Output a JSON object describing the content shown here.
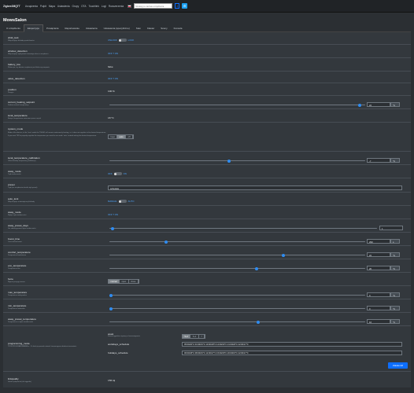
{
  "topbar": {
    "brand": "Zigbee2MQTT",
    "nav": [
      "Urządzenia",
      "Pulpit",
      "Mapa",
      "Ustawienia",
      "Grupy",
      "OTA",
      "Touchlink",
      "Logi",
      "Rozszerzenia"
    ],
    "search_placeholder": "Szukaj po nazwie urządzenia",
    "lock_icon": "lock-icon",
    "settings_icon": "gear-icon"
  },
  "page_title": "MowsSalon",
  "tabs": [
    {
      "label": "O urządzeniu",
      "active": false
    },
    {
      "label": "Ekspozycje",
      "active": true
    },
    {
      "label": "Powiązania",
      "active": false
    },
    {
      "label": "Raportowanie",
      "active": false
    },
    {
      "label": "Ustawienia",
      "active": false
    },
    {
      "label": "Ustawienia (specyficzne)",
      "active": false
    },
    {
      "label": "Stan",
      "active": false
    },
    {
      "label": "Klaster",
      "active": false
    },
    {
      "label": "Sceny",
      "active": false
    },
    {
      "label": "Konsola",
      "active": false
    }
  ],
  "rows": {
    "child_lock": {
      "name": "child_lock",
      "desc": "Włącz/wyłącz blokadę przed dziećmi",
      "left": "UNLOCK",
      "right": "LOCK"
    },
    "window_detection": {
      "name": "window_detection",
      "desc": "Włącz/wyłącz wykrywanie otwartego okna w urządzeniu",
      "value": "OFF ? ON"
    },
    "battery_low": {
      "name": "battery_low",
      "desc": "Wskazuje, czy bateria urządzenia jest bliska wyczerpania",
      "value": "false"
    },
    "valve_detection": {
      "name": "valve_detection",
      "value": "OFF ? ON"
    },
    "position": {
      "name": "position",
      "desc": "Pozycja",
      "value": "100 %"
    },
    "current_heating_setpoint": {
      "name": "current_heating_setpoint",
      "desc": "Zadana wartość temperatury",
      "value": "22",
      "unit": "°C"
    },
    "local_temperature": {
      "name": "local_temperature",
      "desc": "Bieżąca temperatura zmierzona przez czujnik",
      "value": "18 °C"
    },
    "system_mode": {
      "name": "system_mode",
      "desc": "Mode of this device, in the `heat` mode the TS0601 will remain continuously heating, i.e. it does not regulate to the desired temperature. If you want TRV to properly regulate the temperature you need to use mode `auto` instead setting the desired temperature.",
      "options": [
        "heat",
        "auto",
        "off"
      ],
      "selected": "auto"
    },
    "local_temperature_calibration": {
      "name": "local_temperature_calibration",
      "desc": "Offset lokalnej temperatury (kalibracja)",
      "value": "-7",
      "unit": "°C"
    },
    "away_mode": {
      "name": "away_mode",
      "desc": "Tryb nieobecności",
      "left": "OFF",
      "right": "ON"
    },
    "preset": {
      "name": "preset",
      "desc": "Tryb (ten urządzenie określa tryb preset)",
      "value": "schedule"
    },
    "auto_lock": {
      "name": "auto_lock",
      "desc": "Włącz/wyłącz automatyczną blokadę",
      "left": "MANUAL",
      "right": "AUTO"
    },
    "away_mode2": {
      "name": "away_mode",
      "desc": "Wyłącz tryb nieobecności",
      "value": "OFF ? ON"
    },
    "away_preset_days": {
      "name": "away_preset_days",
      "desc": "Dni obowiązywania trybu nieobecności",
      "value": "1"
    },
    "boost_time": {
      "name": "boost_time",
      "desc": "Czas trwania boost",
      "value": "299",
      "unit": "s"
    },
    "comfort_temperature": {
      "name": "comfort_temperature",
      "desc": "Temperatura komfortowa",
      "value": "22",
      "unit": "°C"
    },
    "eco_temperature": {
      "name": "eco_temperature",
      "desc": "Temperatura eko",
      "value": "20",
      "unit": "°C"
    },
    "force": {
      "name": "force",
      "desc": "Wymuś pozycję zaworu",
      "options": [
        "normal",
        "open",
        "close"
      ],
      "selected": "normal"
    },
    "max_temperature": {
      "name": "max_temperature",
      "desc": "Temperatura maksymalna",
      "value": "0",
      "unit": "°C"
    },
    "min_temperature": {
      "name": "min_temperature",
      "desc": "Temperatura minimalna",
      "value": "0",
      "unit": "°C"
    },
    "away_preset_temperature": {
      "name": "away_preset_temperature",
      "desc": "Temperatura w trybie nieobecności",
      "value": "16",
      "unit": "°C"
    },
    "programming_mode": {
      "name": "programming_mode",
      "desc": "TRYB PROGRAMOWANIA  ⏷ - Ta funkcja pozwala ustawić harmonogram działania termostatu.",
      "week_label": "week",
      "week_desc": "Format tygodnia używany w harmonogramie",
      "week_options": [
        "5+2",
        "6+1",
        "7"
      ],
      "week_selected": "5+2",
      "workdays_label": "workdays_schedule",
      "workdays_value": "05:00/20°C 04:30/15°C 10:00/18°C 12:00/22°C 21:00/20°C 22:00/17°C",
      "holidays_label": "holidays_schedule",
      "holidays_value": "06:00/18°C 08:00/15°C 12:00/17°C 15:00/20°C 20:00/15°C 22:00/17°C",
      "save": "Zatwierdź"
    },
    "linkquality": {
      "name": "linkquality",
      "desc": "Jakość połączenia (siła sygnału)",
      "value": "156 lqi"
    }
  }
}
